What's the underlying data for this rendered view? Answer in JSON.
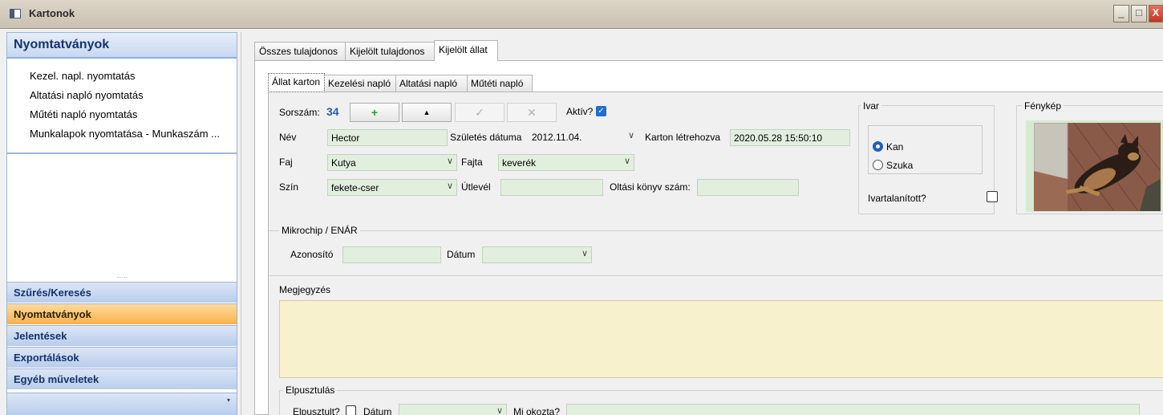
{
  "window": {
    "title": "Kartonok",
    "minimize": "_",
    "maximize": "□",
    "close": "X"
  },
  "left_panel": {
    "header": "Nyomtatványok",
    "items": [
      {
        "label": "Kezel. napl. nyomtatás"
      },
      {
        "label": "Altatási napló nyomtatás"
      },
      {
        "label": "Műtéti napló nyomtatás"
      },
      {
        "label": "Munkalapok nyomtatása - Munkaszám ..."
      }
    ],
    "splitter_dots": "......",
    "categories": [
      {
        "label": "Szűrés/Keresés",
        "active": false
      },
      {
        "label": "Nyomtatványok",
        "active": true
      },
      {
        "label": "Jelentések",
        "active": false
      },
      {
        "label": "Exportálások",
        "active": false
      },
      {
        "label": "Egyéb műveletek",
        "active": false
      }
    ],
    "footer_arrow": "▾"
  },
  "tabs_top": [
    {
      "label": "Összes tulajdonos"
    },
    {
      "label": "Kijelölt tulajdonos"
    },
    {
      "label": "Kijelölt állat",
      "selected": true
    }
  ],
  "tabs_inner": [
    {
      "label": "Állat karton",
      "selected": true
    },
    {
      "label": "Kezelési napló"
    },
    {
      "label": "Altatási napló"
    },
    {
      "label": "Műtéti napló"
    }
  ],
  "form": {
    "sorszam_label": "Sorszám:",
    "sorszam_value": "34",
    "btn_add": "+",
    "btn_up": "▲",
    "btn_ok": "✓",
    "btn_cancel": "✕",
    "aktiv_label": "Aktív?",
    "aktiv_checked": true,
    "nev_label": "Név",
    "nev_value": "Hector",
    "szuletes_label": "Születés dátuma",
    "szuletes_value": "2012.11.04.",
    "karton_label": "Karton létrehozva",
    "karton_value": "2020.05.28 15:50:10",
    "faj_label": "Faj",
    "faj_value": "Kutya",
    "fajta_label": "Fajta",
    "fajta_value": "keverék",
    "szin_label": "Szín",
    "szin_value": "fekete-cser",
    "utlevel_label": "Útlevél",
    "utlevel_value": "",
    "oltasi_label": "Oltási könyv szám:",
    "oltasi_value": ""
  },
  "ivar": {
    "title": "Ivar",
    "options": [
      {
        "label": "Kan",
        "selected": true
      },
      {
        "label": "Szuka",
        "selected": false
      }
    ],
    "ivartalanitott_label": "Ivartalanított?",
    "ivartalanitott_checked": false
  },
  "fenykep": {
    "title": "Fénykép"
  },
  "mikrochip": {
    "title": "Mikrochip / ENÁR",
    "azonosito_label": "Azonosító",
    "azonosito_value": "",
    "datum_label": "Dátum",
    "datum_value": ""
  },
  "megjegyzes": {
    "title": "Megjegyzés",
    "value": ""
  },
  "elpusztulas": {
    "title": "Elpusztulás",
    "elpusztult_label": "Elpusztult?",
    "datum_label": "Dátum",
    "okozta_label": "Mi okozta?"
  },
  "colors": {
    "nav_text": "#14336e",
    "active_category": "#f8b24c",
    "field_bg": "#e2efdf",
    "note_bg": "#f7f1cd",
    "accent_blue": "#1f5fc0"
  }
}
